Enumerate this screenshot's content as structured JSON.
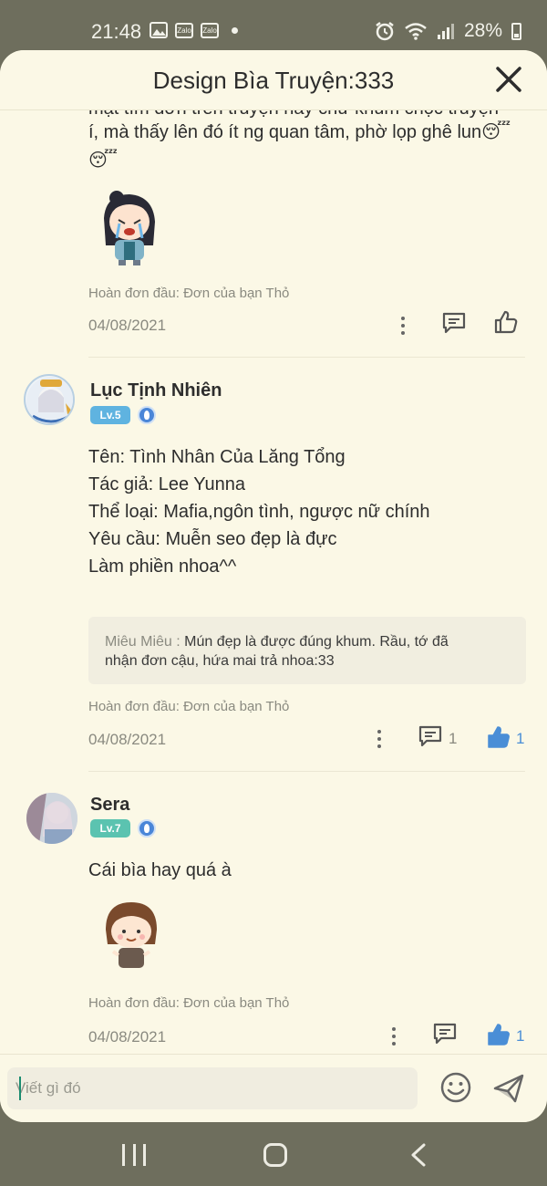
{
  "status_bar": {
    "time": "21:48",
    "notification_icons": [
      "image-icon",
      "zalo-icon",
      "zalo-icon",
      "dot-icon"
    ],
    "zalo_label": "Zalo",
    "right_icons": [
      "alarm-icon",
      "wifi-icon",
      "signal-icon"
    ],
    "battery": "28%"
  },
  "header": {
    "title": "Design Bìa Truyện:333",
    "close_icon": "close-icon"
  },
  "comments": [
    {
      "partial_text_cut": "mặt tìm đơn trên truyện hay chứ khum chọc truyện",
      "text_line_1": "í, mà thấy lên đó ít ng quan tâm, phờ lọp ghê lun",
      "emoji": "😴",
      "sticker_icon": "chibi-girl-crying-sticker",
      "meta": "Hoàn đơn đầu: Đơn của bạn Thỏ",
      "date": "04/08/2021"
    },
    {
      "author": "Lục Tịnh Nhiên",
      "level": "Lv.5",
      "level_color": "#5fb3e0",
      "body": [
        "Tên: Tình Nhân Của Lăng Tổng",
        "Tác giả: Lee Yunna",
        "Thể loại: Mafia,ngôn tình, ngược nữ chính",
        "Yêu cầu: Muễn seo đẹp là đực",
        "Làm phiền nhoa^^"
      ],
      "reply": {
        "author": "Miêu Miêu :",
        "text_line_1": "Mún đẹp là được đúng khum. Rầu, tớ đã",
        "text_line_2": "nhận đơn cậu, hứa mai trả nhoa:33"
      },
      "meta": "Hoàn đơn đầu: Đơn của bạn Thỏ",
      "date": "04/08/2021",
      "comment_count": "1",
      "like_count": "1"
    },
    {
      "author": "Sera",
      "level": "Lv.7",
      "level_color": "#5bc3b0",
      "body": [
        "Cái bìa hay quá à"
      ],
      "sticker_icon": "chibi-girl-bob-hair-sticker",
      "meta": "Hoàn đơn đầu: Đơn của bạn Thỏ",
      "date": "04/08/2021",
      "like_count": "1"
    }
  ],
  "composer": {
    "placeholder": "Viết gì đó",
    "emoji_icon": "smiley-icon",
    "send_icon": "send-icon"
  },
  "colors": {
    "sheet_bg": "#fbf8e6",
    "accent_blue": "#4a8ed6",
    "frame": "#6e6e5d"
  }
}
